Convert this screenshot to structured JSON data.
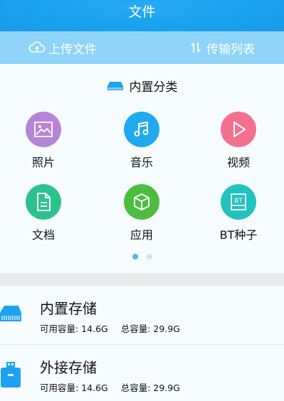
{
  "header": {
    "title": "文件"
  },
  "toolbar": {
    "upload_label": "上传文件",
    "transfer_label": "传输列表"
  },
  "builtin_categories": {
    "title": "内置分类",
    "items": [
      {
        "label": "照片",
        "icon": "image-icon",
        "color": "#b784d6"
      },
      {
        "label": "音乐",
        "icon": "music-icon",
        "color": "#1fa9ef"
      },
      {
        "label": "视频",
        "icon": "play-icon",
        "color": "#f3708f"
      },
      {
        "label": "文档",
        "icon": "document-icon",
        "color": "#2cc28e"
      },
      {
        "label": "应用",
        "icon": "box-icon",
        "color": "#4cbd3f"
      },
      {
        "label": "BT种子",
        "icon": "bt-icon",
        "color": "#22c2c0"
      }
    ],
    "pagination": {
      "pages": 2,
      "active": 1
    }
  },
  "storage": [
    {
      "name": "内置存储",
      "available": "可用容量: 14.6G",
      "total": "总容量: 29.9G",
      "icon": "drive-icon"
    },
    {
      "name": "外接存储",
      "available": "可用容量: 14.6G",
      "total": "总容量: 29.9G",
      "icon": "usb-icon"
    }
  ],
  "colors": {
    "header": "#18a2f0",
    "toolbar": "#8fd4f8",
    "accent": "#1da1f2",
    "dot_active": "#55b6ef",
    "dot_inactive": "#dddddd"
  }
}
